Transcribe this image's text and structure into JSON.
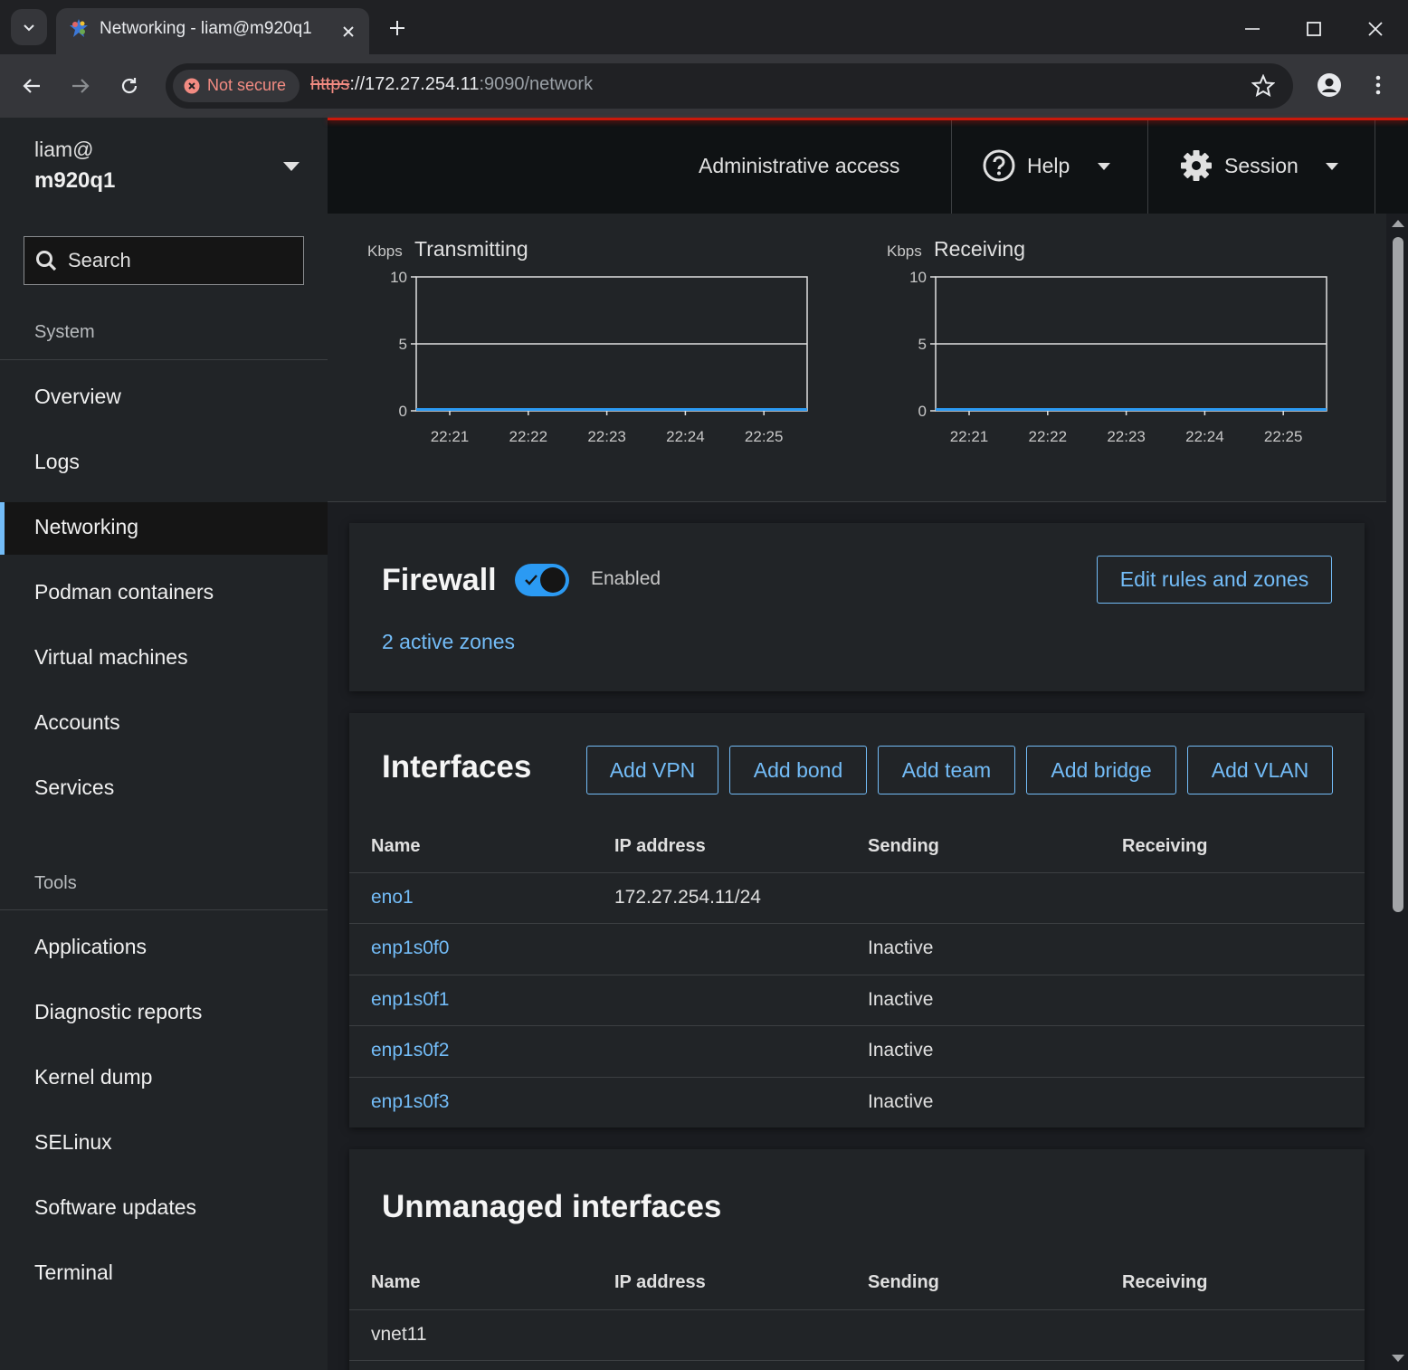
{
  "browser": {
    "tab_title": "Networking - liam@m920q1",
    "security_label": "Not secure",
    "url_scheme": "https",
    "url_host": "://172.27.254.11",
    "url_rest": ":9090/network"
  },
  "masthead": {
    "host_user": "liam@",
    "host_name": "m920q1",
    "admin_access": "Administrative access",
    "help_label": "Help",
    "session_label": "Session"
  },
  "sidebar": {
    "search_placeholder": "Search",
    "system_label": "System",
    "system_items": [
      {
        "label": "Overview"
      },
      {
        "label": "Logs"
      },
      {
        "label": "Networking",
        "active": true
      },
      {
        "label": "Podman containers"
      },
      {
        "label": "Virtual machines"
      },
      {
        "label": "Accounts"
      },
      {
        "label": "Services"
      }
    ],
    "tools_label": "Tools",
    "tools_items": [
      {
        "label": "Applications"
      },
      {
        "label": "Diagnostic reports"
      },
      {
        "label": "Kernel dump"
      },
      {
        "label": "SELinux"
      },
      {
        "label": "Software updates"
      },
      {
        "label": "Terminal"
      }
    ]
  },
  "chart_data": [
    {
      "type": "line",
      "title": "Transmitting",
      "ylabel": "Kbps",
      "x": [
        "22:21",
        "22:22",
        "22:23",
        "22:24",
        "22:25"
      ],
      "ylim": [
        0,
        10
      ],
      "yticks": [
        0,
        5,
        10
      ],
      "series": [
        {
          "values": [
            0,
            0,
            0,
            0,
            0
          ]
        }
      ],
      "grid": "horizontal at 5",
      "color": "#2b9af3"
    },
    {
      "type": "line",
      "title": "Receiving",
      "ylabel": "Kbps",
      "x": [
        "22:21",
        "22:22",
        "22:23",
        "22:24",
        "22:25"
      ],
      "ylim": [
        0,
        10
      ],
      "yticks": [
        0,
        5,
        10
      ],
      "series": [
        {
          "values": [
            0,
            0,
            0,
            0,
            0
          ]
        }
      ],
      "grid": "horizontal at 5",
      "color": "#2b9af3"
    }
  ],
  "firewall": {
    "title": "Firewall",
    "status": "Enabled",
    "enabled": true,
    "edit_button": "Edit rules and zones",
    "zones_link": "2 active zones"
  },
  "interfaces": {
    "title": "Interfaces",
    "buttons": [
      "Add VPN",
      "Add bond",
      "Add team",
      "Add bridge",
      "Add VLAN"
    ],
    "columns": [
      "Name",
      "IP address",
      "Sending",
      "Receiving"
    ],
    "rows": [
      {
        "name": "eno1",
        "ip": "172.27.254.11/24",
        "sending": "",
        "receiving": ""
      },
      {
        "name": "enp1s0f0",
        "ip": "",
        "sending": "Inactive",
        "receiving": ""
      },
      {
        "name": "enp1s0f1",
        "ip": "",
        "sending": "Inactive",
        "receiving": ""
      },
      {
        "name": "enp1s0f2",
        "ip": "",
        "sending": "Inactive",
        "receiving": ""
      },
      {
        "name": "enp1s0f3",
        "ip": "",
        "sending": "Inactive",
        "receiving": ""
      }
    ]
  },
  "unmanaged": {
    "title": "Unmanaged interfaces",
    "columns": [
      "Name",
      "IP address",
      "Sending",
      "Receiving"
    ],
    "rows": [
      {
        "name": "vnet11",
        "ip": "",
        "sending": "",
        "receiving": ""
      }
    ]
  },
  "colors": {
    "accent": "#73bcf7",
    "toggle": "#2b9af3",
    "brand_line": "#c9190b",
    "insecure": "#f28b82"
  }
}
